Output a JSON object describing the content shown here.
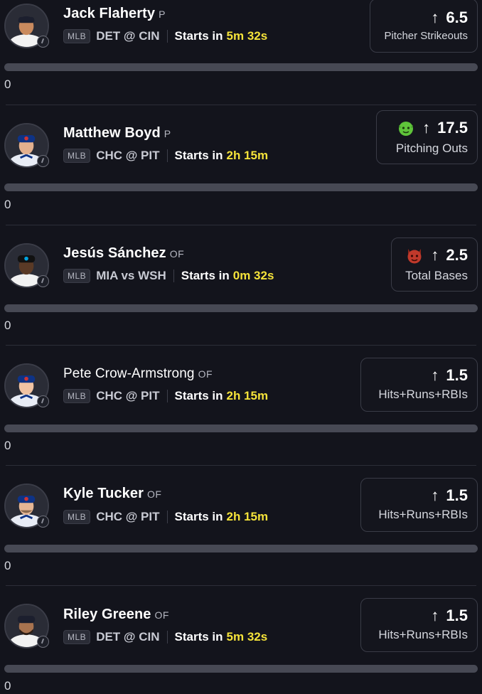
{
  "players": [
    {
      "name": "Jack Flaherty",
      "position": "P",
      "league": "MLB",
      "matchup": "DET @ CIN",
      "starts_label": "Starts in",
      "countdown": "5m 32s",
      "prop_line": "6.5",
      "prop_stat": "Pitcher Strikeouts",
      "direction_icon": "arrow-up-icon",
      "emoji_icon": "",
      "progress_fraction": 0,
      "count": "0",
      "team": "DET"
    },
    {
      "name": "Matthew Boyd",
      "position": "P",
      "league": "MLB",
      "matchup": "CHC @ PIT",
      "starts_label": "Starts in",
      "countdown": "2h 15m",
      "prop_line": "17.5",
      "prop_stat": "Pitching Outs",
      "direction_icon": "arrow-up-icon",
      "emoji_icon": "goblin-icon",
      "progress_fraction": 0,
      "count": "0",
      "team": "CHC"
    },
    {
      "name": "Jesús Sánchez",
      "position": "OF",
      "league": "MLB",
      "matchup": "MIA vs WSH",
      "starts_label": "Starts in",
      "countdown": "0m 32s",
      "prop_line": "2.5",
      "prop_stat": "Total Bases",
      "direction_icon": "arrow-up-icon",
      "emoji_icon": "demon-icon",
      "progress_fraction": 0,
      "count": "0",
      "team": "MIA"
    },
    {
      "name": "Pete Crow-Armstrong",
      "position": "OF",
      "league": "MLB",
      "matchup": "CHC @ PIT",
      "starts_label": "Starts in",
      "countdown": "2h 15m",
      "prop_line": "1.5",
      "prop_stat": "Hits+Runs+RBIs",
      "direction_icon": "arrow-up-icon",
      "emoji_icon": "",
      "progress_fraction": 0,
      "count": "0",
      "team": "CHC"
    },
    {
      "name": "Kyle Tucker",
      "position": "OF",
      "league": "MLB",
      "matchup": "CHC @ PIT",
      "starts_label": "Starts in",
      "countdown": "2h 15m",
      "prop_line": "1.5",
      "prop_stat": "Hits+Runs+RBIs",
      "direction_icon": "arrow-up-icon",
      "emoji_icon": "",
      "progress_fraction": 0,
      "count": "0",
      "team": "CHC"
    },
    {
      "name": "Riley Greene",
      "position": "OF",
      "league": "MLB",
      "matchup": "DET @ CIN",
      "starts_label": "Starts in",
      "countdown": "5m 32s",
      "prop_line": "1.5",
      "prop_stat": "Hits+Runs+RBIs",
      "direction_icon": "arrow-up-icon",
      "emoji_icon": "",
      "progress_fraction": 0,
      "count": "0",
      "team": "DET"
    }
  ],
  "colors": {
    "background": "#13141c",
    "countdown": "#f5e33a",
    "divider": "#2c2e38",
    "progress_track": "#474954",
    "goblin": "#5fc43a",
    "demon": "#c0392b"
  }
}
